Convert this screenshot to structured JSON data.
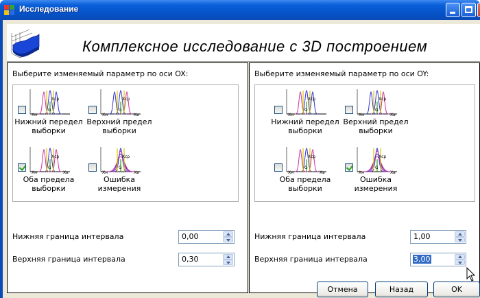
{
  "window": {
    "title": "Исследование",
    "heading": "Комплексное исследование с 3D построением"
  },
  "left_panel": {
    "label": "Выберите изменяемый параметр по оси OX:",
    "options": [
      {
        "line1": "Нижний передел",
        "line2": "выборки",
        "checked": false
      },
      {
        "line1": "Верхний предел",
        "line2": "выборки",
        "checked": false
      },
      {
        "line1": "Оба предела",
        "line2": "выборки",
        "checked": true
      },
      {
        "line1": "Ошибка",
        "line2": "измерения",
        "checked": false
      }
    ],
    "lower_label": "Нижняя граница интервала",
    "lower_value": "0,00",
    "upper_label": "Верхняя граница интервала",
    "upper_value": "0,30"
  },
  "right_panel": {
    "label": "Выберите изменяемый параметр по оси OY:",
    "options": [
      {
        "line1": "Нижний передел",
        "line2": "выборки",
        "checked": false
      },
      {
        "line1": "Верхний предел",
        "line2": "выборки",
        "checked": false
      },
      {
        "line1": "Оба предела",
        "line2": "выборки",
        "checked": false
      },
      {
        "line1": "Ошибка",
        "line2": "измерения",
        "checked": true
      }
    ],
    "lower_label": "Нижняя граница интервала",
    "lower_value": "1,00",
    "upper_label": "Верхняя граница интервала",
    "upper_value": "3,00"
  },
  "graph_labels": {
    "xcp": "Xcp",
    "xh": "Xн",
    "xb": "Xв",
    "g": "G"
  },
  "buttons": {
    "cancel": "Отмена",
    "back": "Назад",
    "ok": "OK"
  },
  "colors": {
    "titlebar": "#0553c8",
    "frame": "#ece9d8",
    "curve_pink": "#cc3399",
    "curve_blue": "#3333cc",
    "line_yellow": "#d8c800",
    "line_green": "#2a9a2a"
  }
}
